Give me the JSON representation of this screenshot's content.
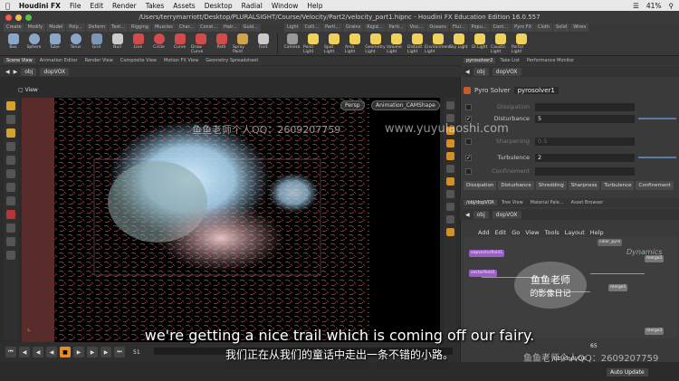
{
  "menubar": {
    "app_name": "Houdini FX",
    "items": [
      "File",
      "Edit",
      "Render",
      "Takes",
      "Assets",
      "Desktop",
      "Radial",
      "Window",
      "Help"
    ],
    "status": "41%"
  },
  "window": {
    "title": "/Users/terrymarriott/Desktop/PLURALSIGHT/Course/Velocity/Part2/velocity_part1.hipnc - Houdini FX Education Edition 16.0.557"
  },
  "shelf": {
    "tabs_left": [
      "Create",
      "Modify",
      "Model",
      "Poly...",
      "Deform",
      "Text...",
      "Rigging",
      "Muscles",
      "Char...",
      "Const...",
      "Hair...",
      "Guid..."
    ],
    "tabs_right": [
      "Light",
      "Colli...",
      "Parti...",
      "Grains",
      "Rigid...",
      "Parti...",
      "Visc...",
      "Oceans",
      "Flui...",
      "Popu...",
      "Cont...",
      "Pyro FX",
      "Cloth",
      "Solid",
      "Wires"
    ],
    "tools_left": [
      "Box",
      "Sphere",
      "Tube",
      "Torus",
      "Grid",
      "Null",
      "Line",
      "Circle",
      "Curve",
      "Draw Curve",
      "Path",
      "Spray Paint",
      "Font"
    ],
    "tools_right": [
      "Camera",
      "Point Light",
      "Spot Light",
      "Area Light",
      "Geometry Light",
      "Volume Light",
      "Distant Light",
      "Environment Light",
      "Sky Light",
      "GI Light",
      "Caustic Light",
      "Portal Light"
    ]
  },
  "viewer": {
    "tabs": [
      "Scene View",
      "Animation Editor",
      "Render View",
      "Composite View",
      "Motion FX View",
      "Geometry Spreadsheet"
    ],
    "path": [
      "obj",
      "dopVOX"
    ],
    "label": "View",
    "persp": "Persp",
    "camera": "Animation_CAMShape"
  },
  "params": {
    "tabs": [
      "pyrosolver2",
      "Take List",
      "Performance Monitor"
    ],
    "path": [
      "obj",
      "dopVOX"
    ],
    "node_type": "Pyro Solver",
    "node_name": "pyrosolver1",
    "rows": [
      {
        "label": "Dissipation",
        "checked": false,
        "value": "",
        "enabled": false
      },
      {
        "label": "Disturbance",
        "checked": true,
        "value": "5",
        "enabled": true
      },
      {
        "label": "Sharpening",
        "checked": false,
        "value": "0.5",
        "enabled": false
      },
      {
        "label": "Turbulence",
        "checked": true,
        "value": "2",
        "enabled": true
      },
      {
        "label": "Confinement",
        "checked": false,
        "value": "",
        "enabled": false
      }
    ],
    "subtabs": [
      "Dissipation",
      "Disturbance",
      "Shredding",
      "Sharpness",
      "Turbulence",
      "Confinement"
    ]
  },
  "network": {
    "tabs": [
      "/obj/dopVOX",
      "Tree View",
      "Material Pale...",
      "Asset Browser"
    ],
    "path": [
      "obj",
      "dopVOX"
    ],
    "menu": [
      "Add",
      "Edit",
      "Go",
      "View",
      "Tools",
      "Layout",
      "Help"
    ],
    "node_labels": [
      "vopvectorfield1",
      "vectorfield1",
      "merge1",
      "color_pyro",
      "merge2",
      "merge3"
    ],
    "context": "Dynamics",
    "bottom_path": "/obj/dopVOX",
    "auto_update": "Auto Update"
  },
  "playbar": {
    "current_frame": "51",
    "end_frame": "51",
    "right_frame": "65"
  },
  "subtitles": {
    "english": "we're getting a nice trail which is coming off our fairy.",
    "chinese": "我们正在从我们的童话中走出一条不错的小路。"
  },
  "watermarks": {
    "left": "鱼鱼老师个人QQ：2609207759",
    "center": "www.yuyulaoshi.com",
    "bottom": "鱼鱼老师个人QQ：2609207759",
    "logo_line1": "鱼鱼老师",
    "logo_line2": "的影像日记"
  },
  "colors": {
    "accent_orange": "#e48d2b",
    "node_purple": "#9a5fc7",
    "noise_red": "#c2443a",
    "smoke_blue": "#a9d4ef"
  }
}
